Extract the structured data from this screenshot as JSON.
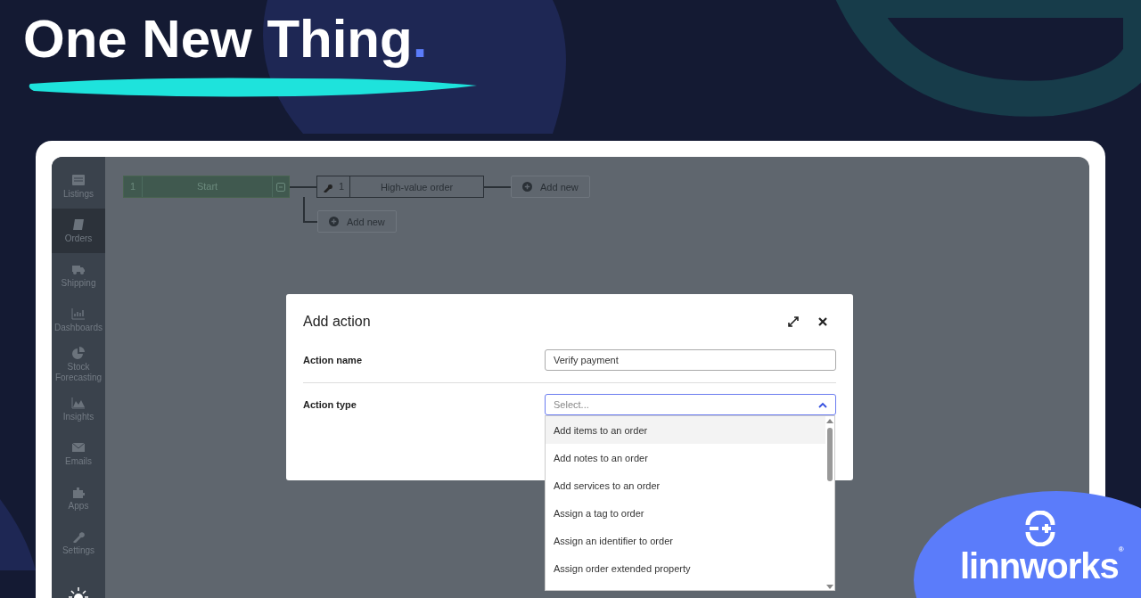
{
  "headline": {
    "text": "One New Thing",
    "mark": "."
  },
  "sidebar": {
    "items": [
      {
        "label": "Listings",
        "selected": false
      },
      {
        "label": "Orders",
        "selected": true
      },
      {
        "label": "Shipping",
        "selected": false
      },
      {
        "label": "Dashboards",
        "selected": false
      },
      {
        "label": "Stock Forecasting",
        "selected": false
      },
      {
        "label": "Insights",
        "selected": false
      },
      {
        "label": "Emails",
        "selected": false
      },
      {
        "label": "Apps",
        "selected": false
      },
      {
        "label": "Settings",
        "selected": false
      }
    ]
  },
  "flow": {
    "start": {
      "number": "1",
      "label": "Start"
    },
    "node": {
      "number": "1",
      "label": "High-value order"
    },
    "add_buttons": [
      "Add new",
      "Add new"
    ]
  },
  "dialog": {
    "title": "Add action",
    "fields": [
      {
        "label": "Action name",
        "kind": "text",
        "value": "Verify payment"
      },
      {
        "label": "Action type",
        "kind": "select",
        "placeholder": "Select...",
        "expanded": true
      }
    ],
    "options": [
      {
        "label": "Add items to an order",
        "selected": true
      },
      {
        "label": "Add notes to an order",
        "selected": false
      },
      {
        "label": "Add services to an order",
        "selected": false
      },
      {
        "label": "Assign a tag to order",
        "selected": false
      },
      {
        "label": "Assign an identifier to order",
        "selected": false
      },
      {
        "label": "Assign order extended property",
        "selected": false
      }
    ]
  },
  "logo": {
    "text": "linnworks",
    "registered": "®"
  }
}
